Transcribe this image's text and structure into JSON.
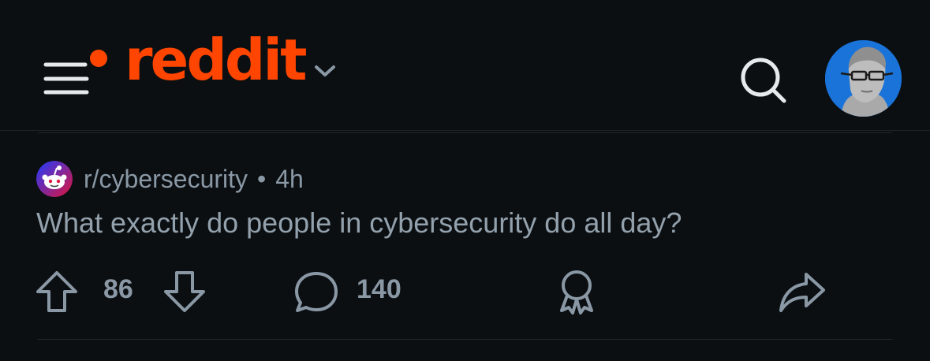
{
  "app": {
    "logo_text": "reddit",
    "brand_color": "#ff4500",
    "background_color": "#0b0f12"
  },
  "header": {
    "menu_icon": "hamburger-menu-icon",
    "notification_dot_color": "#ff4500",
    "logo_dropdown_icon": "chevron-down-icon",
    "search_icon": "search-icon",
    "avatar_icon": "user-avatar"
  },
  "post": {
    "subreddit": "r/cybersecurity",
    "separator": "•",
    "age": "4h",
    "title": "What exactly do people in cybersecurity do all day?",
    "actions": {
      "upvote_icon": "arrow-up-icon",
      "vote_count": "86",
      "downvote_icon": "arrow-down-icon",
      "comment_icon": "comment-bubble-icon",
      "comment_count": "140",
      "award_icon": "award-icon",
      "share_icon": "share-icon"
    }
  }
}
